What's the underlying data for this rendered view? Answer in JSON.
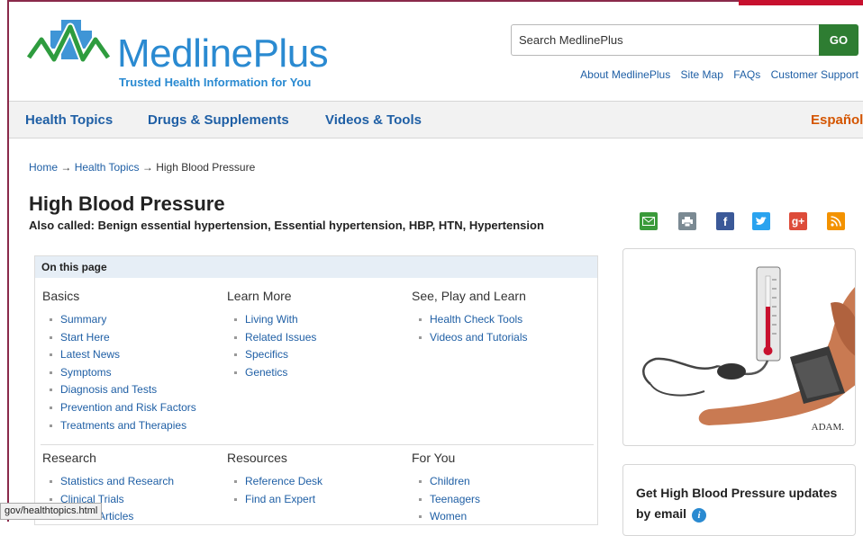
{
  "header": {
    "logo_text": "MedlinePlus",
    "logo_tagline": "Trusted Health Information for You",
    "search_placeholder": "Search MedlinePlus",
    "go_label": "GO",
    "util_links": [
      "About MedlinePlus",
      "Site Map",
      "FAQs",
      "Customer Support"
    ]
  },
  "nav": {
    "items": [
      "Health Topics",
      "Drugs & Supplements",
      "Videos & Tools"
    ],
    "language": "Español"
  },
  "breadcrumb": {
    "home": "Home",
    "sep": "→",
    "section": "Health Topics",
    "current": "High Blood Pressure"
  },
  "page": {
    "title": "High Blood Pressure",
    "also_called": "Also called: Benign essential hypertension, Essential hypertension, HBP, HTN, Hypertension"
  },
  "share_icons": [
    "email-icon",
    "print-icon",
    "facebook-icon",
    "twitter-icon",
    "google-plus-icon",
    "rss-icon"
  ],
  "on_this_page": {
    "heading": "On this page",
    "row1": [
      {
        "title": "Basics",
        "items": [
          "Summary",
          "Start Here",
          "Latest News",
          "Symptoms",
          "Diagnosis and Tests",
          "Prevention and Risk Factors",
          "Treatments and Therapies"
        ]
      },
      {
        "title": "Learn More",
        "items": [
          "Living With",
          "Related Issues",
          "Specifics",
          "Genetics"
        ]
      },
      {
        "title": "See, Play and Learn",
        "items": [
          "Health Check Tools",
          "Videos and Tutorials"
        ]
      }
    ],
    "row2": [
      {
        "title": "Research",
        "items": [
          "Statistics and Research",
          "Clinical Trials",
          "Journal Articles"
        ]
      },
      {
        "title": "Resources",
        "items": [
          "Reference Desk",
          "Find an Expert"
        ]
      },
      {
        "title": "For You",
        "items": [
          "Children",
          "Teenagers",
          "Women"
        ]
      }
    ]
  },
  "image_card": {
    "credit": "ADAM."
  },
  "email_card": {
    "text": "Get High Blood Pressure updates by email"
  },
  "status_bar": {
    "url": "gov/healthtopics.html"
  },
  "colors": {
    "link": "#1f5fa5",
    "brand": "#2a8ad1",
    "go_button": "#2e7d32",
    "espanol": "#d45500"
  }
}
